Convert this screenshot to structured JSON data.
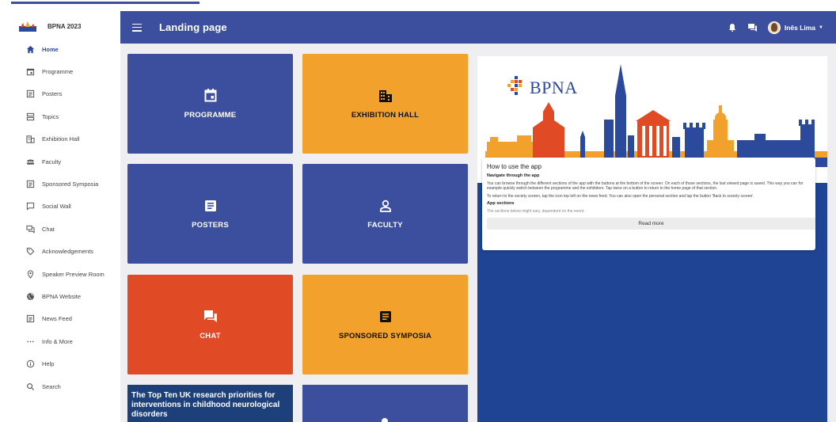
{
  "app": {
    "name": "BPNA 2023"
  },
  "header": {
    "page_title": "Landing page",
    "user_name": "Inês Lima",
    "icons": [
      "menu-icon",
      "bell-icon",
      "chat-icon",
      "avatar"
    ]
  },
  "sidebar": {
    "items": [
      {
        "label": "Home",
        "icon": "home-icon",
        "active": true
      },
      {
        "label": "Programme",
        "icon": "calendar-icon"
      },
      {
        "label": "Posters",
        "icon": "document-icon"
      },
      {
        "label": "Topics",
        "icon": "topics-icon"
      },
      {
        "label": "Exhibition Hall",
        "icon": "building-icon"
      },
      {
        "label": "Faculty",
        "icon": "people-icon"
      },
      {
        "label": "Sponsored Symposia",
        "icon": "document-icon"
      },
      {
        "label": "Social Wall",
        "icon": "comment-icon"
      },
      {
        "label": "Chat",
        "icon": "chat-icon"
      },
      {
        "label": "Acknowledgements",
        "icon": "tag-icon"
      },
      {
        "label": "Speaker Preview Room",
        "icon": "location-icon"
      },
      {
        "label": "BPNA Website",
        "icon": "globe-icon"
      },
      {
        "label": "News Feed",
        "icon": "document-icon"
      },
      {
        "label": "Info & More",
        "icon": "more-icon"
      },
      {
        "label": "Help",
        "icon": "info-icon"
      },
      {
        "label": "Search",
        "icon": "search-icon"
      }
    ]
  },
  "tiles": [
    {
      "label": "PROGRAMME",
      "icon": "calendar-icon",
      "color": "#3b4f9e"
    },
    {
      "label": "EXHIBITION HALL",
      "icon": "building-icon",
      "color": "#f2a12d"
    },
    {
      "label": "POSTERS",
      "icon": "document-icon",
      "color": "#3b4f9e"
    },
    {
      "label": "FACULTY",
      "icon": "person-icon",
      "color": "#3b4f9e"
    },
    {
      "label": "CHAT",
      "icon": "chat-icon",
      "color": "#e04a24"
    },
    {
      "label": "SPONSORED SYMPOSIA",
      "icon": "document-icon",
      "color": "#f2a12d"
    }
  ],
  "promo": {
    "title": "The Top Ten UK research priorities for interventions in childhood neurological disorders"
  },
  "panel": {
    "logo_text": "BPNA",
    "card": {
      "title": "How to use the app",
      "subtitle1": "Navigate through the app",
      "p1": "You can browse through the different sections of the app with the buttons at the bottom of the screen. On each of those sections, the last viewed page is saved. This way you can for example quickly switch between the programme and the exhibitors. Tap twice on a button to return to the home page of that section.",
      "p2": "To return to the society screen, tap the icon top left on the news feed. You can also open the personal section and tap the button 'Back to society screen'.",
      "subtitle2": "App sections",
      "p3": "The sections below might vary, dependent on the event.",
      "button": "Read more"
    }
  },
  "colors": {
    "primary": "#3b4f9e",
    "orange": "#f2a12d",
    "red": "#e04a24",
    "panel_blue": "#1e4493"
  }
}
